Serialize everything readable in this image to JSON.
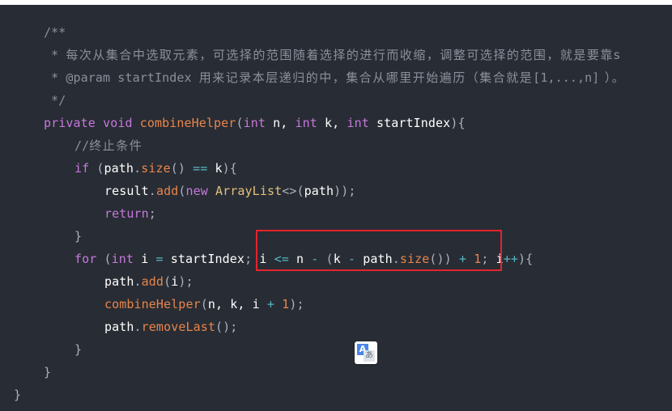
{
  "code": {
    "language": "java",
    "lines": [
      [
        {
          "t": "/**",
          "c": "comment"
        }
      ],
      [
        {
          "t": " * ",
          "c": "comment"
        },
        {
          "t": "每次从集合中选取元素，可选择的范围随着选择的进行而收缩，调整可选择的范围，就是要靠s",
          "c": "comment cjk"
        }
      ],
      [
        {
          "t": " * @param startIndex ",
          "c": "comment"
        },
        {
          "t": "用来记录本层递归的中，集合从哪里开始遍历（集合就是",
          "c": "comment cjk"
        },
        {
          "t": "[1,...,n]",
          "c": "comment"
        },
        {
          "t": " ）。",
          "c": "comment cjk"
        }
      ],
      [
        {
          "t": " */",
          "c": "comment"
        }
      ],
      [
        {
          "t": "private",
          "c": "keyword"
        },
        {
          "t": " ",
          "c": "punct"
        },
        {
          "t": "void",
          "c": "keyword"
        },
        {
          "t": " ",
          "c": "punct"
        },
        {
          "t": "combineHelper",
          "c": "fn"
        },
        {
          "t": "(",
          "c": "punct"
        },
        {
          "t": "int",
          "c": "keyword"
        },
        {
          "t": " n, ",
          "c": "ident"
        },
        {
          "t": "int",
          "c": "keyword"
        },
        {
          "t": " k, ",
          "c": "ident"
        },
        {
          "t": "int",
          "c": "keyword"
        },
        {
          "t": " startIndex",
          "c": "ident"
        },
        {
          "t": "){",
          "c": "punct"
        }
      ],
      [
        {
          "t": "//",
          "c": "comment"
        },
        {
          "t": "终止条件",
          "c": "comment cjk"
        }
      ],
      [
        {
          "t": "if",
          "c": "keyword"
        },
        {
          "t": " (",
          "c": "punct"
        },
        {
          "t": "path",
          "c": "ident"
        },
        {
          "t": ".",
          "c": "punct"
        },
        {
          "t": "size",
          "c": "fn"
        },
        {
          "t": "() ",
          "c": "punct"
        },
        {
          "t": "==",
          "c": "op"
        },
        {
          "t": " k",
          "c": "ident"
        },
        {
          "t": "){",
          "c": "punct"
        }
      ],
      [
        {
          "t": "result",
          "c": "ident"
        },
        {
          "t": ".",
          "c": "punct"
        },
        {
          "t": "add",
          "c": "fn"
        },
        {
          "t": "(",
          "c": "punct"
        },
        {
          "t": "new",
          "c": "keyword"
        },
        {
          "t": " ",
          "c": "punct"
        },
        {
          "t": "ArrayList",
          "c": "class"
        },
        {
          "t": "<>",
          "c": "punct"
        },
        {
          "t": "(",
          "c": "punct"
        },
        {
          "t": "path",
          "c": "ident"
        },
        {
          "t": "));",
          "c": "punct"
        }
      ],
      [
        {
          "t": "return",
          "c": "keyword"
        },
        {
          "t": ";",
          "c": "punct"
        }
      ],
      [
        {
          "t": "}",
          "c": "punct"
        }
      ],
      [
        {
          "t": "for",
          "c": "keyword"
        },
        {
          "t": " (",
          "c": "punct"
        },
        {
          "t": "int",
          "c": "keyword"
        },
        {
          "t": " i ",
          "c": "ident"
        },
        {
          "t": "=",
          "c": "op"
        },
        {
          "t": " startIndex",
          "c": "ident"
        },
        {
          "t": "; ",
          "c": "punct"
        },
        {
          "t": "i ",
          "c": "ident"
        },
        {
          "t": "<=",
          "c": "op"
        },
        {
          "t": " n ",
          "c": "ident"
        },
        {
          "t": "-",
          "c": "op"
        },
        {
          "t": " (",
          "c": "punct"
        },
        {
          "t": "k ",
          "c": "ident"
        },
        {
          "t": "-",
          "c": "op"
        },
        {
          "t": " path",
          "c": "ident"
        },
        {
          "t": ".",
          "c": "punct"
        },
        {
          "t": "size",
          "c": "fn"
        },
        {
          "t": "()) ",
          "c": "punct"
        },
        {
          "t": "+",
          "c": "op"
        },
        {
          "t": " ",
          "c": "punct"
        },
        {
          "t": "1",
          "c": "num"
        },
        {
          "t": "; ",
          "c": "punct"
        },
        {
          "t": "i",
          "c": "ident"
        },
        {
          "t": "++",
          "c": "op"
        },
        {
          "t": "){",
          "c": "punct"
        }
      ],
      [
        {
          "t": "path",
          "c": "ident"
        },
        {
          "t": ".",
          "c": "punct"
        },
        {
          "t": "add",
          "c": "fn"
        },
        {
          "t": "(",
          "c": "punct"
        },
        {
          "t": "i",
          "c": "ident"
        },
        {
          "t": ");",
          "c": "punct"
        }
      ],
      [
        {
          "t": "combineHelper",
          "c": "fn"
        },
        {
          "t": "(",
          "c": "punct"
        },
        {
          "t": "n, k, i ",
          "c": "ident"
        },
        {
          "t": "+",
          "c": "op"
        },
        {
          "t": " ",
          "c": "punct"
        },
        {
          "t": "1",
          "c": "num"
        },
        {
          "t": ");",
          "c": "punct"
        }
      ],
      [
        {
          "t": "path",
          "c": "ident"
        },
        {
          "t": ".",
          "c": "punct"
        },
        {
          "t": "removeLast",
          "c": "fn"
        },
        {
          "t": "();",
          "c": "punct"
        }
      ],
      [
        {
          "t": "}",
          "c": "punct"
        }
      ],
      [
        {
          "t": "}",
          "c": "punct"
        }
      ],
      [
        {
          "t": "}",
          "c": "punct"
        }
      ]
    ],
    "highlighted_expression": "i <= n - (k - path.size()) + 1;"
  },
  "translate_button": {
    "icon": "google-translate-icon",
    "label_a": "A",
    "label_b": "あ"
  },
  "colors": {
    "background": "#282c34",
    "highlight_border": "#e5232e"
  }
}
